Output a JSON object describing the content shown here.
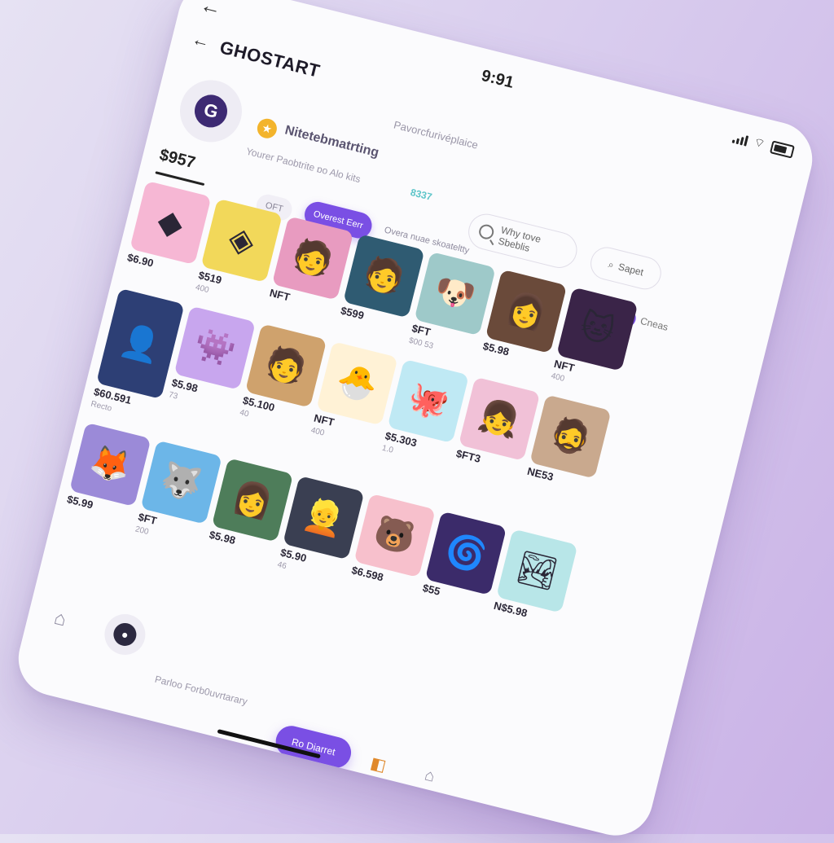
{
  "status": {
    "time": "9:91"
  },
  "header": {
    "brand": "GHOSTART",
    "marketplace": "Pavorcfurivéplaice"
  },
  "logo": {
    "letter": "G"
  },
  "balance": "$957",
  "collection": {
    "title": "Nitetebmatrting",
    "subtitle": "Yourer Paobtrite ɒo Alo kits",
    "price": "8337"
  },
  "search": {
    "placeholder": "Why tove Sbeblis"
  },
  "save_button": "Sapet",
  "chips": {
    "inactive": "OFT",
    "active": "Overest Eerr"
  },
  "sort_label": "Overa nuae skoateltty",
  "filter": {
    "icon": "6",
    "label": "Cneas"
  },
  "cards": [
    {
      "price": "$6.90",
      "sub": "",
      "icon": "geometric-art-icon",
      "glyph": "◆",
      "bg": "#f6b7d4",
      "tall": false
    },
    {
      "price": "$519",
      "sub": "400",
      "icon": "geometric-art-icon",
      "glyph": "◈",
      "bg": "#f2d85a",
      "tall": false
    },
    {
      "price": "NFT",
      "sub": "",
      "icon": "pink-hair-avatar-icon",
      "glyph": "🧑",
      "bg": "#e89bc0",
      "tall": false
    },
    {
      "price": "$599",
      "sub": "",
      "icon": "teal-hair-avatar-icon",
      "glyph": "🧑",
      "bg": "#2f5b72",
      "tall": false
    },
    {
      "price": "$FT",
      "sub": "$00 53",
      "icon": "robot-dog-icon",
      "glyph": "🐶",
      "bg": "#9ec9c9",
      "tall": false
    },
    {
      "price": "$5.98",
      "sub": "",
      "icon": "redhead-avatar-icon",
      "glyph": "👩",
      "bg": "#6a4a3a",
      "tall": false
    },
    {
      "price": "NFT",
      "sub": "400",
      "icon": "purple-cat-icon",
      "glyph": "🐱",
      "bg": "#3a2448",
      "tall": false
    },
    {
      "price": "$60.591",
      "sub": "Recto",
      "icon": "space-girl-icon",
      "glyph": "👤",
      "bg": "#2d3f75",
      "tall": true
    },
    {
      "price": "$5.98",
      "sub": "73",
      "icon": "violet-creature-icon",
      "glyph": "👾",
      "bg": "#c8a6ee",
      "tall": false
    },
    {
      "price": "$5.100",
      "sub": "40",
      "icon": "punk-avatar-icon",
      "glyph": "🧑",
      "bg": "#cfa26d",
      "tall": false
    },
    {
      "price": "NFT",
      "sub": "400",
      "icon": "orange-blob-icon",
      "glyph": "🐣",
      "bg": "#fff2d6",
      "tall": false
    },
    {
      "price": "$5.303",
      "sub": "1.0",
      "icon": "cyan-octopus-icon",
      "glyph": "🐙",
      "bg": "#bfe9f4",
      "tall": false
    },
    {
      "price": "$FT3",
      "sub": "",
      "icon": "colorful-girl-icon",
      "glyph": "👧",
      "bg": "#f1c1d7",
      "tall": false
    },
    {
      "price": "NE53",
      "sub": "",
      "icon": "glasses-man-icon",
      "glyph": "🧔",
      "bg": "#c9a98e",
      "tall": false
    },
    {
      "price": "$5.99",
      "sub": "",
      "icon": "neon-fox-icon",
      "glyph": "🦊",
      "bg": "#9b8ad8",
      "tall": false
    },
    {
      "price": "$FT",
      "sub": "200",
      "icon": "blue-wolf-icon",
      "glyph": "🐺",
      "bg": "#6cb6e8",
      "tall": false
    },
    {
      "price": "$5.98",
      "sub": "",
      "icon": "brown-hair-girl-icon",
      "glyph": "👩",
      "bg": "#4e7d5a",
      "tall": false
    },
    {
      "price": "$5.90",
      "sub": "46",
      "icon": "silver-hair-avatar-icon",
      "glyph": "👱",
      "bg": "#3a3f52",
      "tall": false
    },
    {
      "price": "$6.598",
      "sub": "",
      "icon": "peach-bear-icon",
      "glyph": "🐻",
      "bg": "#f7c0cc",
      "tall": false
    },
    {
      "price": "$55",
      "sub": "",
      "icon": "cosmic-portal-icon",
      "glyph": "🌀",
      "bg": "#3b2b6a",
      "tall": false
    },
    {
      "price": "N$5.98",
      "sub": "",
      "icon": "landscape-art-icon",
      "glyph": "🏞",
      "bg": "#b8e6e8",
      "tall": false
    }
  ],
  "footer": {
    "note": "Parloo Forb0uvrtarary",
    "cta": "Ro Diarret"
  },
  "colors": {
    "accent": "#7a4fe4",
    "coin": "#f3b42c",
    "price_highlight": "#5bc4c8"
  }
}
